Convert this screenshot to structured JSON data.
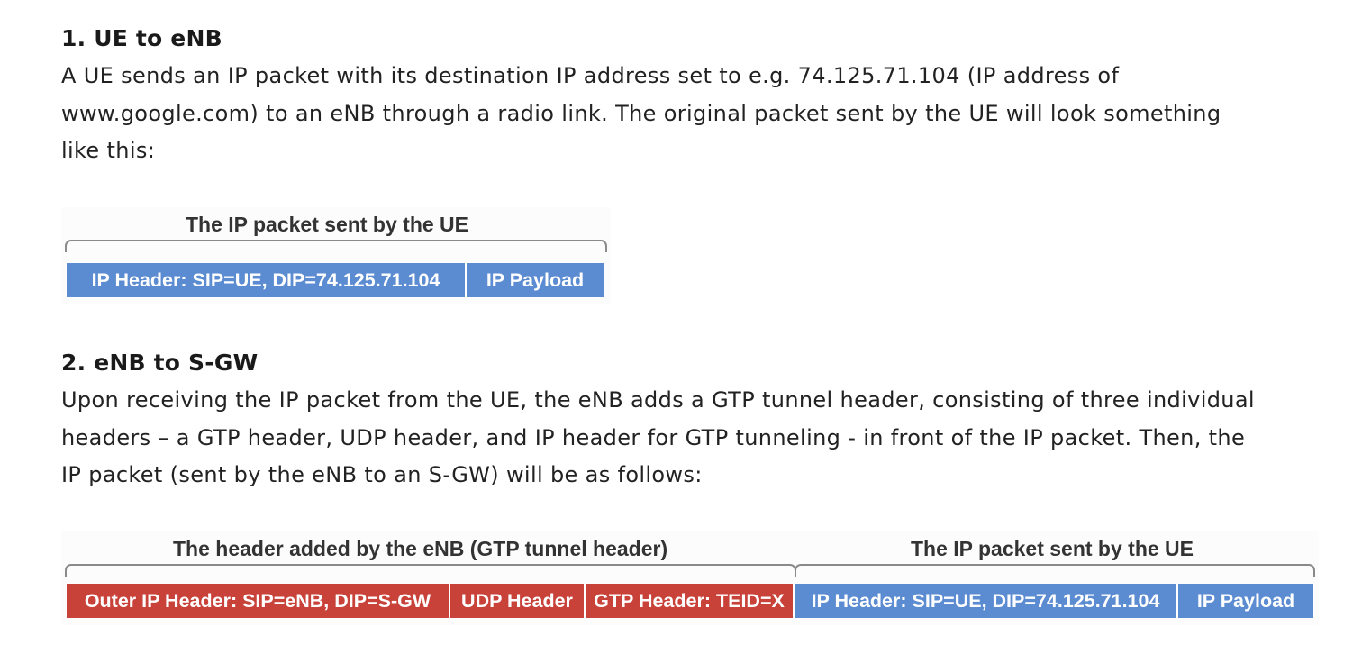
{
  "section1": {
    "heading": "1. UE to eNB",
    "lines": [
      "A UE sends an IP packet with its destination IP address set to e.g. 74.125.71.104 (IP address of",
      "www.google.com) to an eNB through a radio link. The original packet sent by the UE will look something",
      "like this:"
    ],
    "figure": {
      "caption": "The IP packet sent by the UE",
      "segments": [
        {
          "label": "IP Header: SIP=UE, DIP=74.125.71.104",
          "color": "#5b8bd1"
        },
        {
          "label": "IP Payload",
          "color": "#5b8bd1"
        }
      ]
    }
  },
  "section2": {
    "heading": "2. eNB to S-GW",
    "lines": [
      "Upon receiving the IP packet from the UE, the eNB adds a GTP tunnel header, consisting of three individual",
      "headers – a GTP header, UDP header, and IP header for GTP tunneling - in front of the IP packet. Then, the",
      "IP packet (sent by the eNB to an S-GW) will be as follows:"
    ],
    "figure": {
      "caption_left": "The header added by the eNB (GTP tunnel header)",
      "caption_right": "The IP packet sent by the UE",
      "segments": [
        {
          "label": "Outer IP Header: SIP=eNB, DIP=S-GW",
          "color": "#c8423a"
        },
        {
          "label": "UDP Header",
          "color": "#c8423a"
        },
        {
          "label": "GTP Header: TEID=X",
          "color": "#c8423a"
        },
        {
          "label": "IP Header: SIP=UE, DIP=74.125.71.104",
          "color": "#5b8bd1"
        },
        {
          "label": "IP Payload",
          "color": "#5b8bd1"
        }
      ]
    }
  }
}
